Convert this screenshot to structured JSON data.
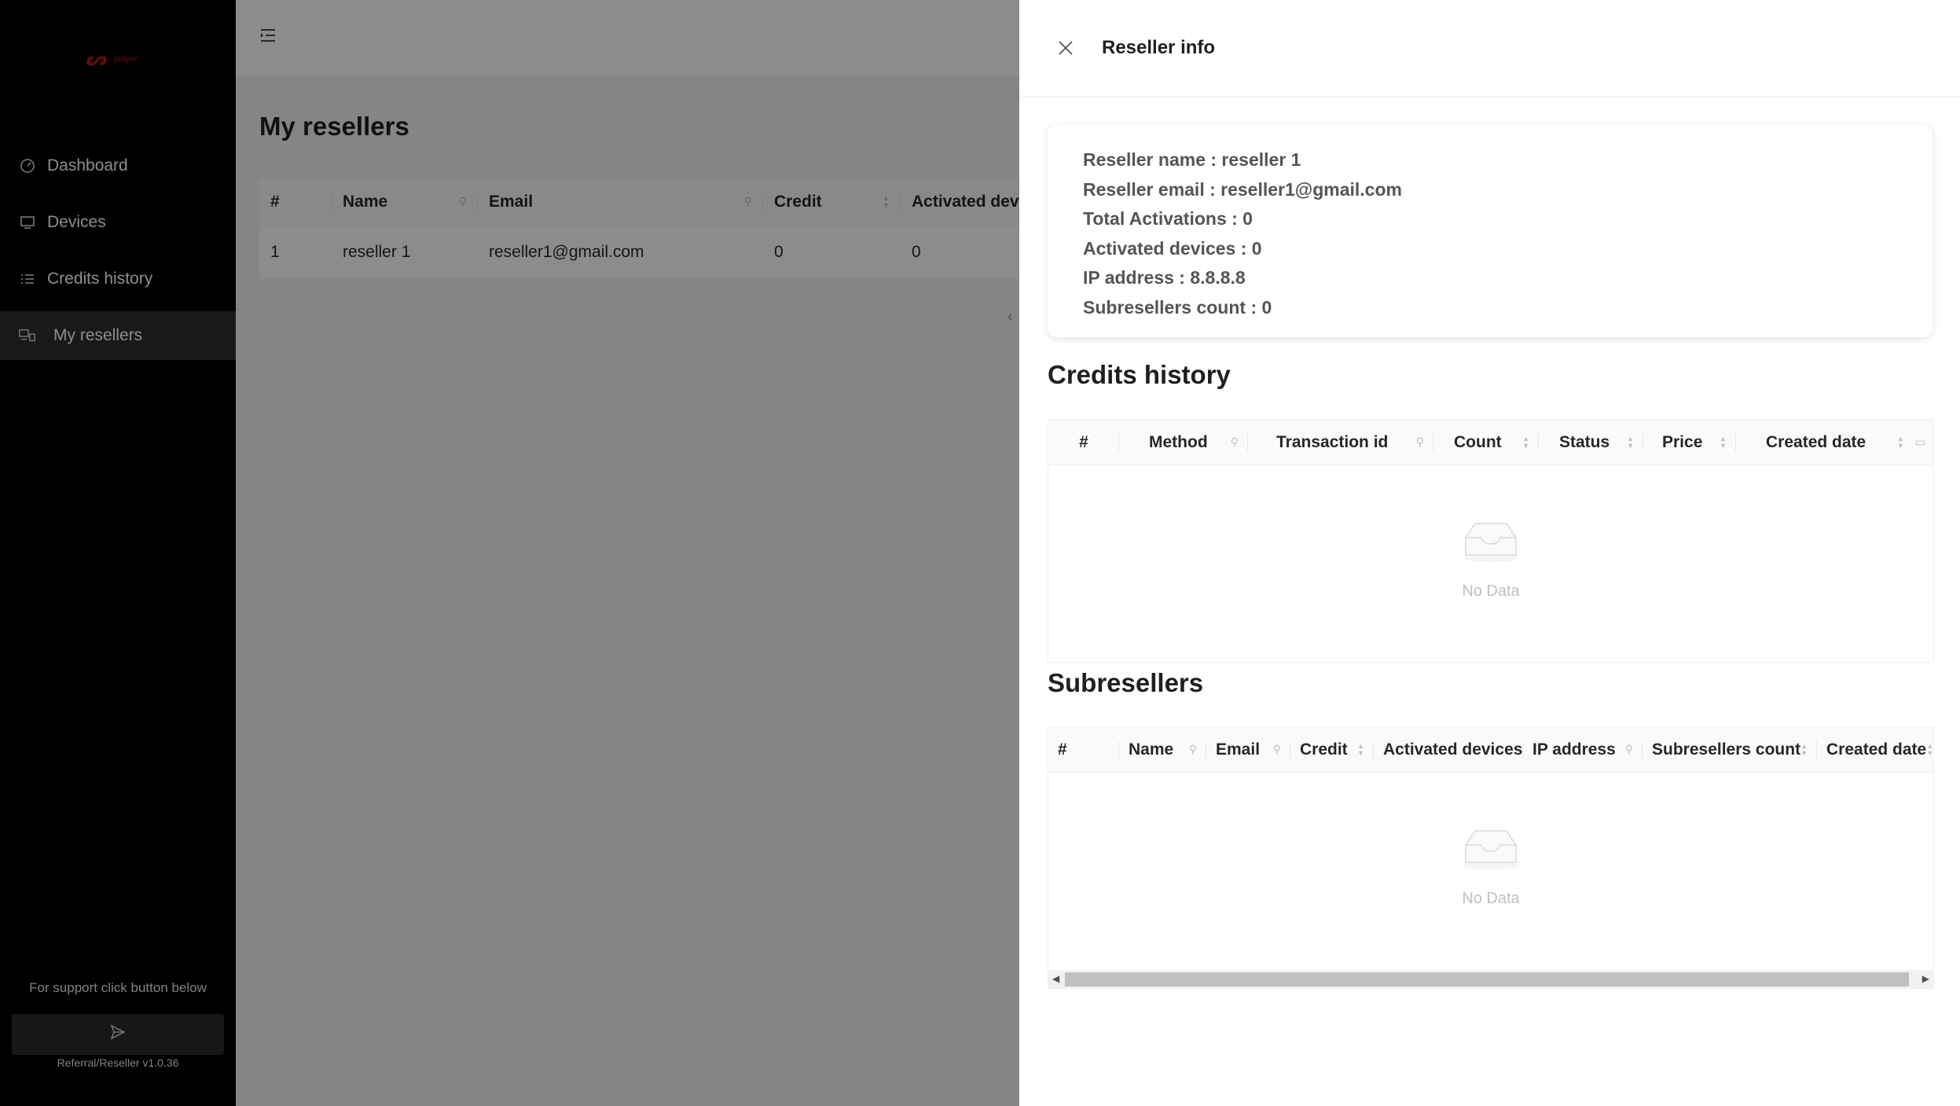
{
  "sidebar": {
    "logo_text": "player",
    "menu": [
      {
        "label": "Dashboard",
        "icon": "dashboard-icon"
      },
      {
        "label": "Devices",
        "icon": "devices-icon"
      },
      {
        "label": "Credits history",
        "icon": "list-icon"
      },
      {
        "label": "My resellers",
        "icon": "resellers-icon",
        "active": true
      }
    ],
    "support_text": "For support click button below",
    "version": "Referral/Reseller v1.0.36"
  },
  "main": {
    "title": "My resellers",
    "table": {
      "headers": [
        "#",
        "Name",
        "Email",
        "Credit",
        "Activated devic"
      ],
      "rows": [
        [
          "1",
          "reseller 1",
          "reseller1@gmail.com",
          "0",
          "0"
        ]
      ]
    }
  },
  "drawer": {
    "title": "Reseller info",
    "info": {
      "name": "Reseller name : reseller 1",
      "email": "Reseller email : reseller1@gmail.com",
      "total_activations": "Total Activations : 0",
      "activated_devices": "Activated devices : 0",
      "ip_address": "IP address : 8.8.8.8",
      "subresellers_count": "Subresellers count : 0"
    },
    "credits_history": {
      "title": "Credits history",
      "headers": [
        "#",
        "Method",
        "Transaction id",
        "Count",
        "Status",
        "Price",
        "Created date"
      ],
      "empty": "No Data"
    },
    "subresellers": {
      "title": "Subresellers",
      "headers": [
        "#",
        "Name",
        "Email",
        "Credit",
        "Activated devices",
        "IP address",
        "Subresellers count",
        "Created date"
      ],
      "empty": "No Data"
    }
  }
}
